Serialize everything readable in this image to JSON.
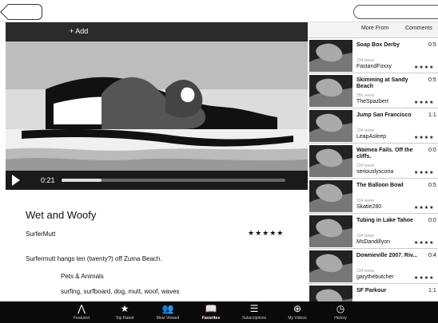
{
  "nav": {
    "search_placeholder": ""
  },
  "video": {
    "top_text": "+ Add",
    "time": "0:21",
    "progress": 0.18
  },
  "details": {
    "title": "Wet and Woofy",
    "author": "SurferMutt",
    "stars": "★★★★★",
    "description": "Surfermutt hangs ten (twenty?) off Zuma Beach.",
    "category": "Pets & Animals",
    "tags": "surfing, surfboard, dog, mutt, woof, waves"
  },
  "right_panel": {
    "tabs": [
      "More From",
      "Comments"
    ],
    "items": [
      {
        "title": "Soap Box Derby",
        "duration": "0:5",
        "views": "234 views",
        "author": "FastandFoxxy",
        "stars": "★★★★"
      },
      {
        "title": "Skimming at Sandy Beach",
        "duration": "0:5",
        "views": "356 views",
        "author": "TheSpazbert",
        "stars": "★★★★"
      },
      {
        "title": "Jump San Francisco",
        "duration": "1:1",
        "views": "234 views",
        "author": "LeapAsleep",
        "stars": "★★★★"
      },
      {
        "title": "Waimea Fails. Off the cliffs.",
        "duration": "0:0",
        "views": "234 views",
        "author": "seriouslyscoria",
        "stars": "★★★★"
      },
      {
        "title": "The Balloon Bowl",
        "duration": "0:5",
        "views": "234 views",
        "author": "Skatie280",
        "stars": "★★★★"
      },
      {
        "title": "Tubing in Lake Tahoe",
        "duration": "0:0",
        "views": "234 views",
        "author": "MsDandillyon",
        "stars": "★★★★"
      },
      {
        "title": "Downieville 2007. Riv...",
        "duration": "0:4",
        "views": "234 views",
        "author": "garythebutcher",
        "stars": "★★★★"
      },
      {
        "title": "SF Parkour",
        "duration": "1:1",
        "views": "",
        "author": "",
        "stars": ""
      }
    ]
  },
  "bottom_nav": [
    {
      "label": "Featured",
      "icon": "featured-icon",
      "active": false
    },
    {
      "label": "Top Rated",
      "icon": "star-icon",
      "active": false
    },
    {
      "label": "Most Viewed",
      "icon": "users-icon",
      "active": false
    },
    {
      "label": "Favorites",
      "icon": "book-icon",
      "active": true
    },
    {
      "label": "Subscriptions",
      "icon": "subscriptions-icon",
      "active": false
    },
    {
      "label": "My Videos",
      "icon": "upload-icon",
      "active": false
    },
    {
      "label": "History",
      "icon": "clock-icon",
      "active": false
    }
  ]
}
